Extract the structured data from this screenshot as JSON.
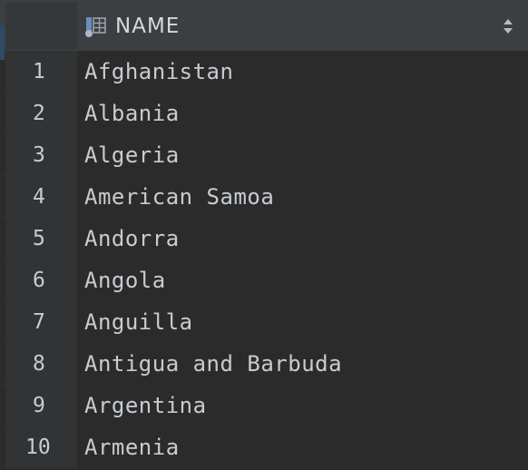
{
  "table": {
    "column_header": "NAME",
    "column_icon": "table-column-icon",
    "sort_icon": "sort-arrows-icon",
    "rows": [
      {
        "num": "1",
        "name": "Afghanistan"
      },
      {
        "num": "2",
        "name": "Albania"
      },
      {
        "num": "3",
        "name": "Algeria"
      },
      {
        "num": "4",
        "name": "American Samoa"
      },
      {
        "num": "5",
        "name": "Andorra"
      },
      {
        "num": "6",
        "name": "Angola"
      },
      {
        "num": "7",
        "name": "Anguilla"
      },
      {
        "num": "8",
        "name": "Antigua and Barbuda"
      },
      {
        "num": "9",
        "name": "Argentina"
      },
      {
        "num": "10",
        "name": "Armenia"
      }
    ]
  },
  "colors": {
    "background": "#2b2b2b",
    "header": "#3c3f41",
    "text": "#c7ccd1",
    "icon_blue": "#6a8fb5"
  }
}
